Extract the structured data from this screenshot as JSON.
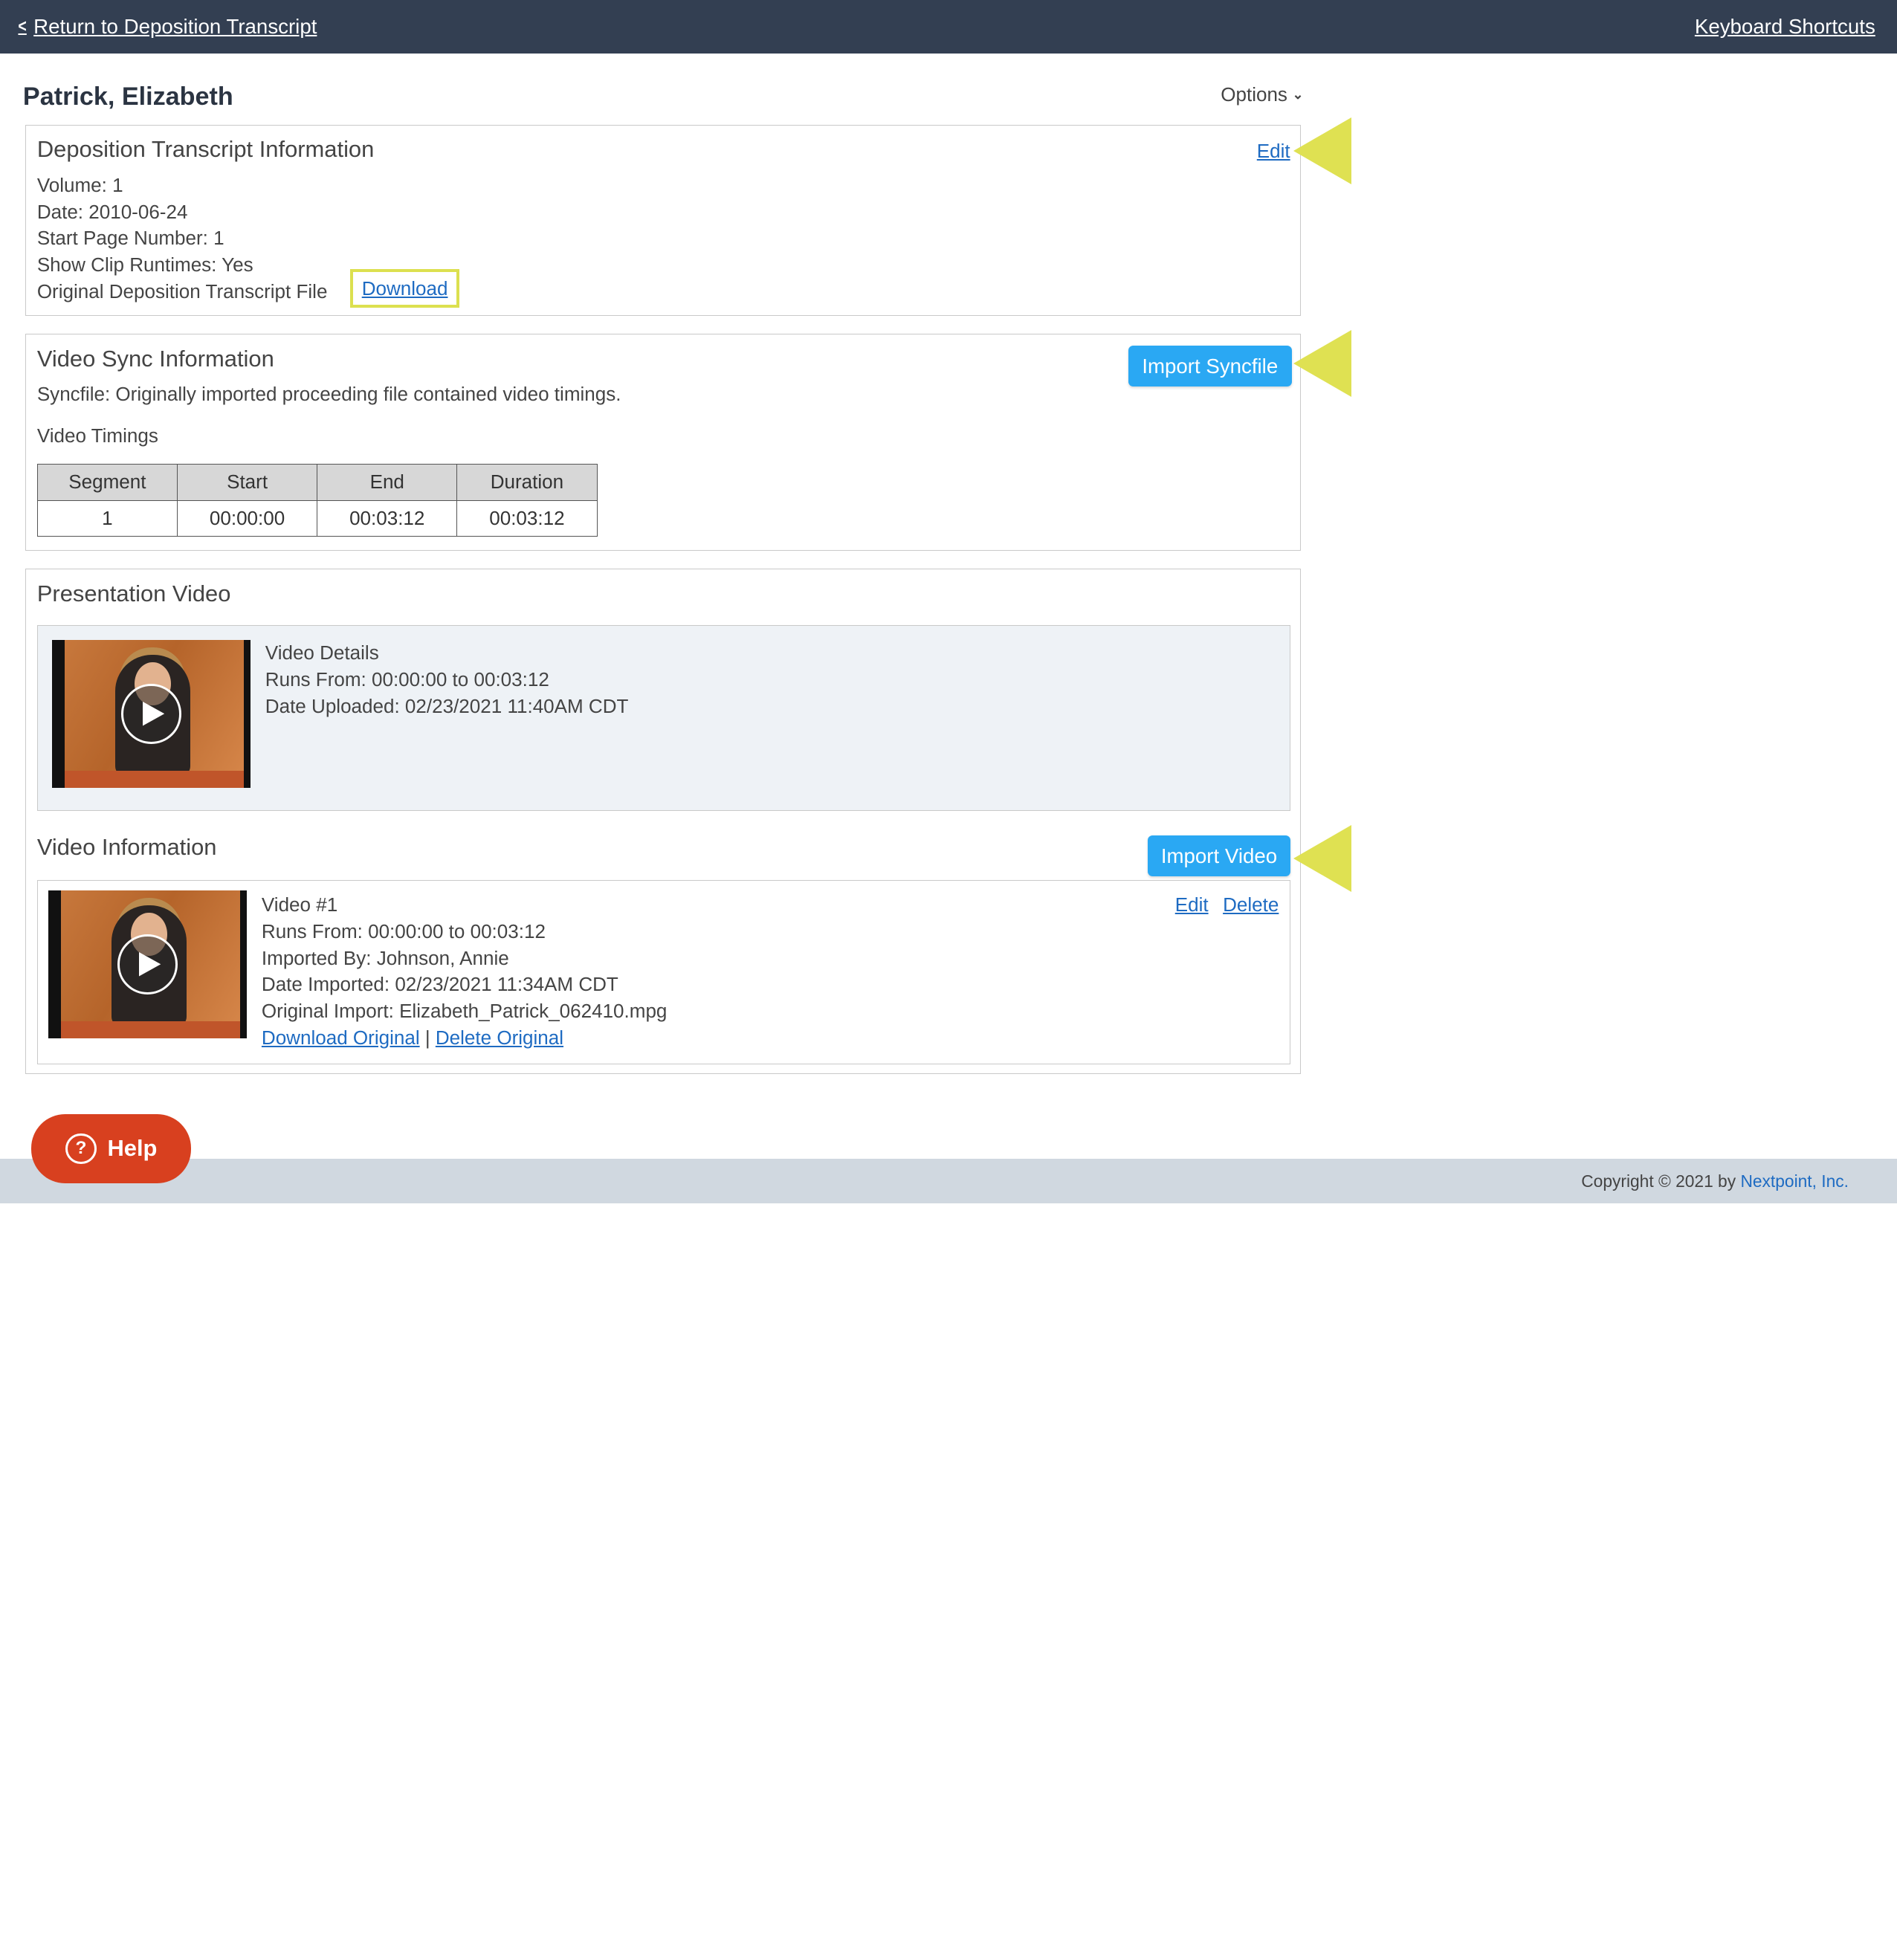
{
  "topbar": {
    "back_label": "Return to Deposition Transcript",
    "shortcuts_label": "Keyboard Shortcuts"
  },
  "page": {
    "title": "Patrick, Elizabeth",
    "options_label": "Options"
  },
  "transcript_info": {
    "title": "Deposition Transcript Information",
    "edit_label": "Edit",
    "volume": "Volume: 1",
    "date": "Date: 2010-06-24",
    "start_page": "Start Page Number: 1",
    "show_clip_runtimes": "Show Clip Runtimes: Yes",
    "original_file_label": "Original Deposition Transcript File",
    "download_label": "Download"
  },
  "video_sync": {
    "title": "Video Sync Information",
    "import_label": "Import Syncfile",
    "syncfile_text": "Syncfile: Originally imported proceeding file contained video timings.",
    "timings_label": "Video Timings",
    "columns": [
      "Segment",
      "Start",
      "End",
      "Duration"
    ],
    "rows": [
      [
        "1",
        "00:00:00",
        "00:03:12",
        "00:03:12"
      ]
    ]
  },
  "presentation_video": {
    "title": "Presentation Video",
    "details_title": "Video Details",
    "runs_from": "Runs From: 00:00:00 to 00:03:12",
    "date_uploaded": "Date Uploaded: 02/23/2021 11:40AM CDT"
  },
  "video_information": {
    "title": "Video Information",
    "import_label": "Import Video",
    "video": {
      "name": "Video #1",
      "runs_from": "Runs From: 00:00:00 to 00:03:12",
      "imported_by": "Imported By: Johnson, Annie",
      "date_imported": "Date Imported: 02/23/2021 11:34AM CDT",
      "original_import": "Original Import: Elizabeth_Patrick_062410.mpg",
      "download_original_label": "Download Original",
      "separator": "|",
      "delete_original_label": "Delete Original",
      "edit_label": "Edit",
      "delete_label": "Delete"
    }
  },
  "help": {
    "label": "Help"
  },
  "footer": {
    "copyright": "Copyright © 2021 by",
    "company": "Nextpoint, Inc."
  },
  "icons": {
    "back": "chevron-left-icon",
    "options": "chevron-down-icon",
    "play": "play-icon",
    "help": "question-circle-icon",
    "annotation": "yellow-arrow-pointer"
  },
  "colors": {
    "topbar": "#333f52",
    "button": "#2aa8f3",
    "link": "#1e6bc2",
    "annotation": "#dfe152",
    "help": "#d8401f",
    "footer": "#d0d8e0"
  }
}
